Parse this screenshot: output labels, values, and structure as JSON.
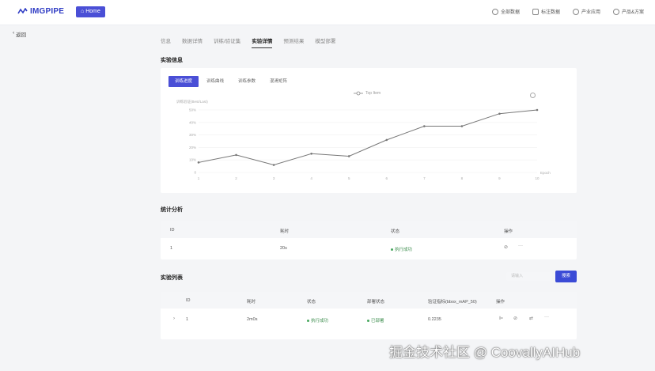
{
  "header": {
    "logo_text": "IMGPIPE",
    "home_label": "Home",
    "nav": [
      "全部数据",
      "标注数据",
      "产业应用",
      "产品&方案"
    ]
  },
  "back_label": "返回",
  "tabs": [
    "信息",
    "数据详情",
    "训练/验证集",
    "实验详情",
    "预测结果",
    "模型部署"
  ],
  "sections": {
    "experiment_info": "实验信息",
    "stats": "统计分析",
    "experiment_list": "实验列表"
  },
  "chart_tabs": [
    "训练进度",
    "训练曲线",
    "训练参数",
    "混淆矩阵"
  ],
  "chart_data": {
    "type": "line",
    "x": [
      1,
      2,
      3,
      4,
      5,
      6,
      7,
      8,
      9,
      10
    ],
    "series": [
      {
        "name": "Top Item",
        "values": [
          0.08,
          0.14,
          0.06,
          0.15,
          0.13,
          0.26,
          0.37,
          0.37,
          0.47,
          0.5
        ]
      }
    ],
    "yticks": [
      "0",
      "10%",
      "20%",
      "30%",
      "40%",
      "50%"
    ],
    "ylim": [
      0,
      0.5
    ],
    "ylabel": "训练验证(Best/Last)",
    "xlabel": "Epoch",
    "grid": true,
    "legend": "top"
  },
  "stats_table": {
    "headers": [
      "ID",
      "耗时",
      "状态",
      "操作"
    ],
    "row": {
      "id": "1",
      "time": "20s",
      "status": "执行成功"
    }
  },
  "list_table": {
    "search_placeholder": "请输入",
    "search_btn": "搜索",
    "headers": [
      "ID",
      "耗时",
      "状态",
      "部署状态",
      "验证指标(bbox_mAP_50)",
      "操作"
    ],
    "row": {
      "id": "1",
      "time": "2m0s",
      "status": "执行成功",
      "deploy": "已部署",
      "metric": "0.2235"
    }
  },
  "watermark": "掘金技术社区 @ CoovallyAIHub",
  "colors": {
    "accent": "#4a4fd6",
    "success": "#48a85f",
    "line": "#777777"
  }
}
